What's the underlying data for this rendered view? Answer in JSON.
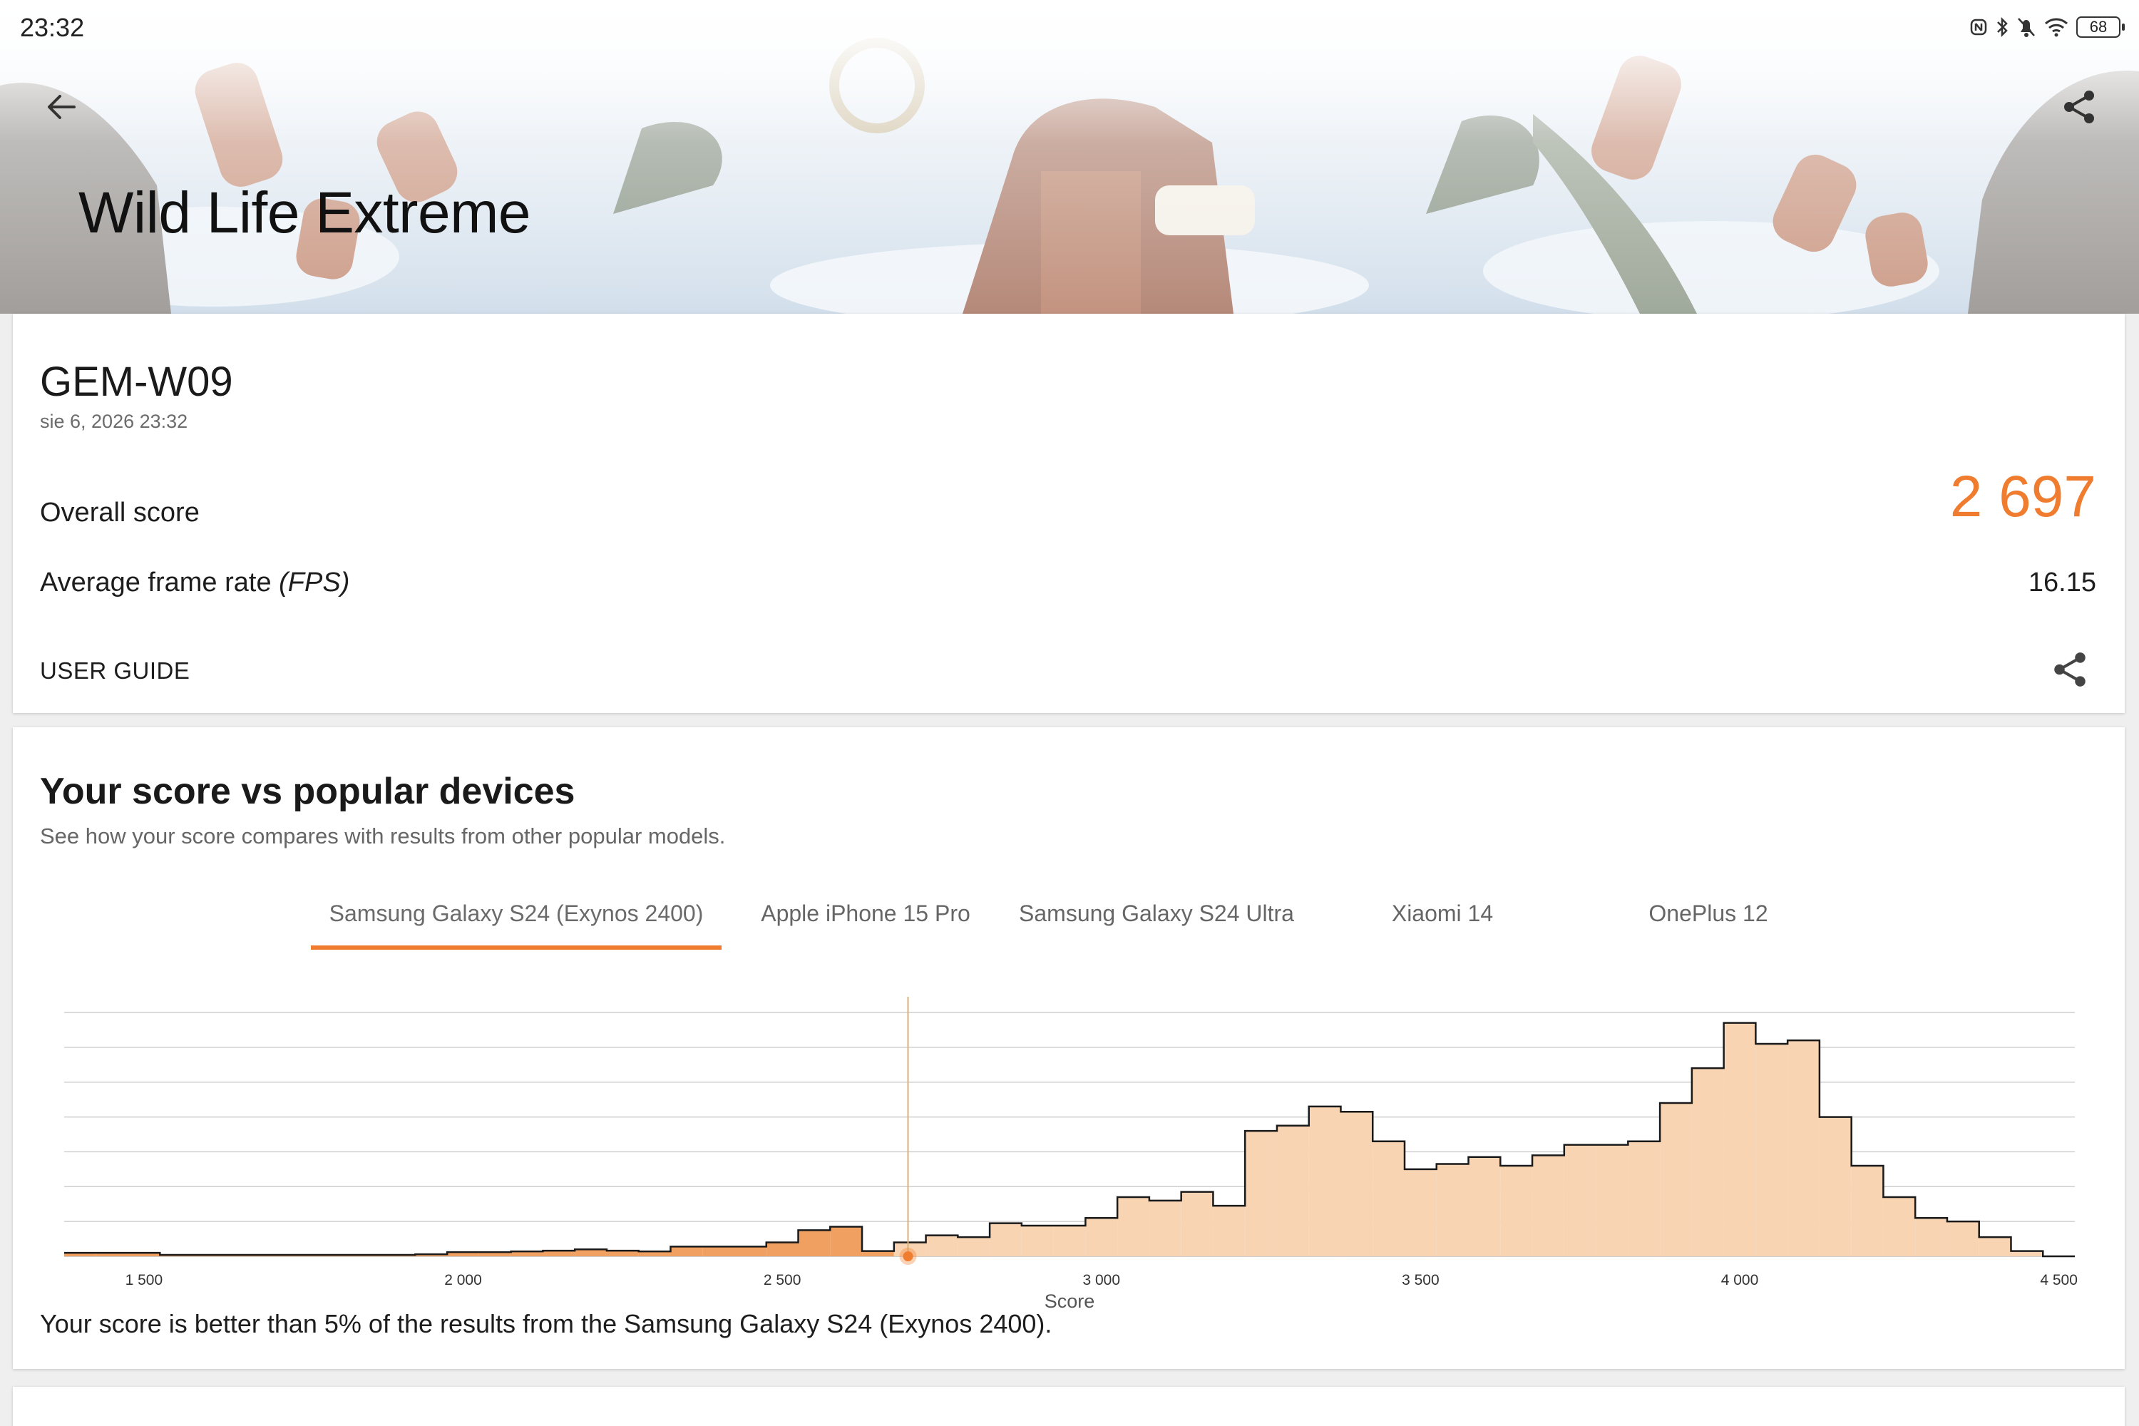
{
  "status_bar": {
    "time": "23:32",
    "battery": "68",
    "icons": [
      "nfc-icon",
      "bluetooth-icon",
      "mute-bell-icon",
      "wifi-icon",
      "battery-icon"
    ]
  },
  "header": {
    "title": "Wild Life Extreme",
    "back_icon": "arrow-left-icon",
    "share_icon": "share-icon"
  },
  "result": {
    "device": "GEM-W09",
    "date": "sie 6, 2026 23:32",
    "overall_label": "Overall score",
    "overall_value": "2 697",
    "fps_label_main": "Average frame rate ",
    "fps_label_unit": "(FPS)",
    "fps_value": "16.15",
    "user_guide": "USER GUIDE"
  },
  "comparison": {
    "title": "Your score vs popular devices",
    "subtitle": "See how your score compares with results from other popular models.",
    "tabs": [
      {
        "label": "Samsung Galaxy S24 (Exynos 2400)",
        "active": true
      },
      {
        "label": "Apple iPhone 15 Pro",
        "active": false
      },
      {
        "label": "Samsung Galaxy S24 Ultra",
        "active": false
      },
      {
        "label": "Xiaomi 14",
        "active": false
      },
      {
        "label": "OnePlus 12",
        "active": false
      }
    ],
    "summary": "Your score is better than 5% of the results from the Samsung Galaxy S24 (Exynos 2400)."
  },
  "colors": {
    "accent": "#f07d2f",
    "histogram_fill": "#f8d4b3",
    "histogram_below_fill": "#f0a060",
    "marker_line": "#d9b27a"
  },
  "chart_data": {
    "type": "area",
    "xlabel": "Score",
    "ylabel": "",
    "xlim": [
      1375,
      4525
    ],
    "ylim": [
      0,
      7
    ],
    "x_ticks": [
      1500,
      2000,
      2500,
      3000,
      3500,
      4000,
      4500
    ],
    "x_tick_labels": [
      "1 500",
      "2 000",
      "2 500",
      "3 000",
      "3 500",
      "4 000",
      "4 500"
    ],
    "grid": true,
    "your_score": 2697,
    "bin_width": 50,
    "bins": [
      {
        "x": 1375,
        "y": 0.1
      },
      {
        "x": 1425,
        "y": 0.1
      },
      {
        "x": 1475,
        "y": 0.1
      },
      {
        "x": 1525,
        "y": 0.04
      },
      {
        "x": 1575,
        "y": 0.04
      },
      {
        "x": 1625,
        "y": 0.04
      },
      {
        "x": 1675,
        "y": 0.04
      },
      {
        "x": 1725,
        "y": 0.04
      },
      {
        "x": 1775,
        "y": 0.04
      },
      {
        "x": 1825,
        "y": 0.04
      },
      {
        "x": 1875,
        "y": 0.04
      },
      {
        "x": 1925,
        "y": 0.06
      },
      {
        "x": 1975,
        "y": 0.12
      },
      {
        "x": 2025,
        "y": 0.12
      },
      {
        "x": 2075,
        "y": 0.14
      },
      {
        "x": 2125,
        "y": 0.16
      },
      {
        "x": 2175,
        "y": 0.2
      },
      {
        "x": 2225,
        "y": 0.16
      },
      {
        "x": 2275,
        "y": 0.14
      },
      {
        "x": 2325,
        "y": 0.28
      },
      {
        "x": 2375,
        "y": 0.28
      },
      {
        "x": 2425,
        "y": 0.28
      },
      {
        "x": 2475,
        "y": 0.4
      },
      {
        "x": 2525,
        "y": 0.75
      },
      {
        "x": 2575,
        "y": 0.85
      },
      {
        "x": 2625,
        "y": 0.15
      },
      {
        "x": 2675,
        "y": 0.4
      },
      {
        "x": 2725,
        "y": 0.6
      },
      {
        "x": 2775,
        "y": 0.55
      },
      {
        "x": 2825,
        "y": 0.95
      },
      {
        "x": 2875,
        "y": 0.88
      },
      {
        "x": 2925,
        "y": 0.88
      },
      {
        "x": 2975,
        "y": 1.1
      },
      {
        "x": 3025,
        "y": 1.7
      },
      {
        "x": 3075,
        "y": 1.6
      },
      {
        "x": 3125,
        "y": 1.85
      },
      {
        "x": 3175,
        "y": 1.45
      },
      {
        "x": 3225,
        "y": 3.6
      },
      {
        "x": 3275,
        "y": 3.75
      },
      {
        "x": 3325,
        "y": 4.3
      },
      {
        "x": 3375,
        "y": 4.15
      },
      {
        "x": 3425,
        "y": 3.3
      },
      {
        "x": 3475,
        "y": 2.5
      },
      {
        "x": 3525,
        "y": 2.65
      },
      {
        "x": 3575,
        "y": 2.85
      },
      {
        "x": 3625,
        "y": 2.6
      },
      {
        "x": 3675,
        "y": 2.9
      },
      {
        "x": 3725,
        "y": 3.2
      },
      {
        "x": 3775,
        "y": 3.2
      },
      {
        "x": 3825,
        "y": 3.3
      },
      {
        "x": 3875,
        "y": 4.4
      },
      {
        "x": 3925,
        "y": 5.4
      },
      {
        "x": 3975,
        "y": 6.7
      },
      {
        "x": 4025,
        "y": 6.1
      },
      {
        "x": 4075,
        "y": 6.2
      },
      {
        "x": 4125,
        "y": 4.0
      },
      {
        "x": 4175,
        "y": 2.6
      },
      {
        "x": 4225,
        "y": 1.7
      },
      {
        "x": 4275,
        "y": 1.1
      },
      {
        "x": 4325,
        "y": 1.0
      },
      {
        "x": 4375,
        "y": 0.55
      },
      {
        "x": 4425,
        "y": 0.15
      },
      {
        "x": 4475,
        "y": 0.0
      }
    ]
  }
}
